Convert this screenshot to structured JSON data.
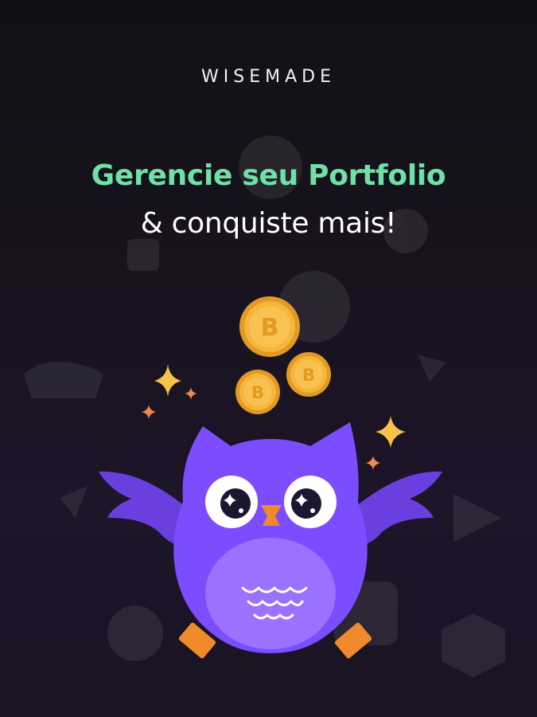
{
  "brand": {
    "logo_text": "WISEMADE"
  },
  "hero": {
    "headline": "Gerencie seu Portfolio",
    "subline": "& conquiste mais!"
  },
  "colors": {
    "background": "#15111c",
    "headline": "#6fe0a6",
    "owl_body": "#7c4dff",
    "owl_belly": "#9b72ff",
    "coin": "#f6b53c",
    "sparkle": "#f6c24a"
  },
  "illustration": {
    "coin_symbol": "B"
  }
}
